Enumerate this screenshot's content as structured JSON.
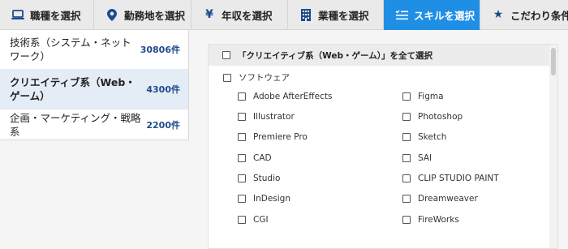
{
  "tabs": [
    {
      "label": "職種を選択",
      "icon": "laptop-icon",
      "active": false
    },
    {
      "label": "勤務地を選択",
      "icon": "map-pin-icon",
      "active": false
    },
    {
      "label": "年収を選択",
      "icon": "yen-icon",
      "active": false
    },
    {
      "label": "業種を選択",
      "icon": "building-icon",
      "active": false
    },
    {
      "label": "スキルを選択",
      "icon": "skill-list-icon",
      "active": true
    },
    {
      "label": "こだわり条件",
      "icon": "star-icon",
      "active": false
    }
  ],
  "categories": [
    {
      "label": "技術系（システム・ネットワーク）",
      "count": "30806件",
      "active": false
    },
    {
      "label": "クリエイティブ系（Web・ゲーム）",
      "count": "4300件",
      "active": true
    },
    {
      "label": "企画・マーケティング・戦略系",
      "count": "2200件",
      "active": false
    }
  ],
  "skills": {
    "select_all_label": "「クリエイティブ系（Web・ゲーム）」を全て選択",
    "parent_label": "ソフトウェア",
    "left_column": [
      "Adobe AfterEffects",
      "Illustrator",
      "Premiere Pro",
      "CAD",
      "Studio",
      "InDesign",
      "CGI"
    ],
    "right_column": [
      "Figma",
      "Photoshop",
      "Sketch",
      "SAI",
      "CLIP STUDIO PAINT",
      "Dreamweaver",
      "FireWorks"
    ]
  },
  "colors": {
    "accent": "#1f8fe6",
    "navy": "#1f4b8c",
    "active_bg": "#e4ecf6"
  }
}
